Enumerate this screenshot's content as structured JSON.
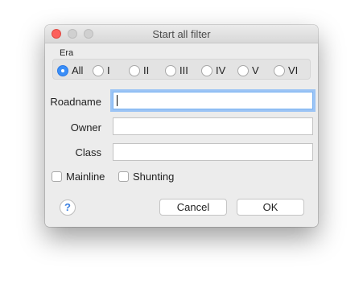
{
  "window": {
    "title": "Start all filter"
  },
  "era": {
    "label": "Era",
    "options": [
      {
        "label": "All",
        "checked": true
      },
      {
        "label": "I",
        "checked": false
      },
      {
        "label": "II",
        "checked": false
      },
      {
        "label": "III",
        "checked": false
      },
      {
        "label": "IV",
        "checked": false
      },
      {
        "label": "V",
        "checked": false
      },
      {
        "label": "VI",
        "checked": false
      }
    ]
  },
  "fields": {
    "roadname": {
      "label": "Roadname",
      "value": ""
    },
    "owner": {
      "label": "Owner",
      "value": ""
    },
    "class": {
      "label": "Class",
      "value": ""
    }
  },
  "checkboxes": {
    "mainline": {
      "label": "Mainline",
      "checked": false
    },
    "shunting": {
      "label": "Shunting",
      "checked": false
    }
  },
  "buttons": {
    "help": "?",
    "cancel": "Cancel",
    "ok": "OK"
  },
  "colors": {
    "accent": "#3a8ef7",
    "close": "#fc605c",
    "focus_ring": "#9cc4f5"
  },
  "icons": {
    "help": "help-icon"
  }
}
